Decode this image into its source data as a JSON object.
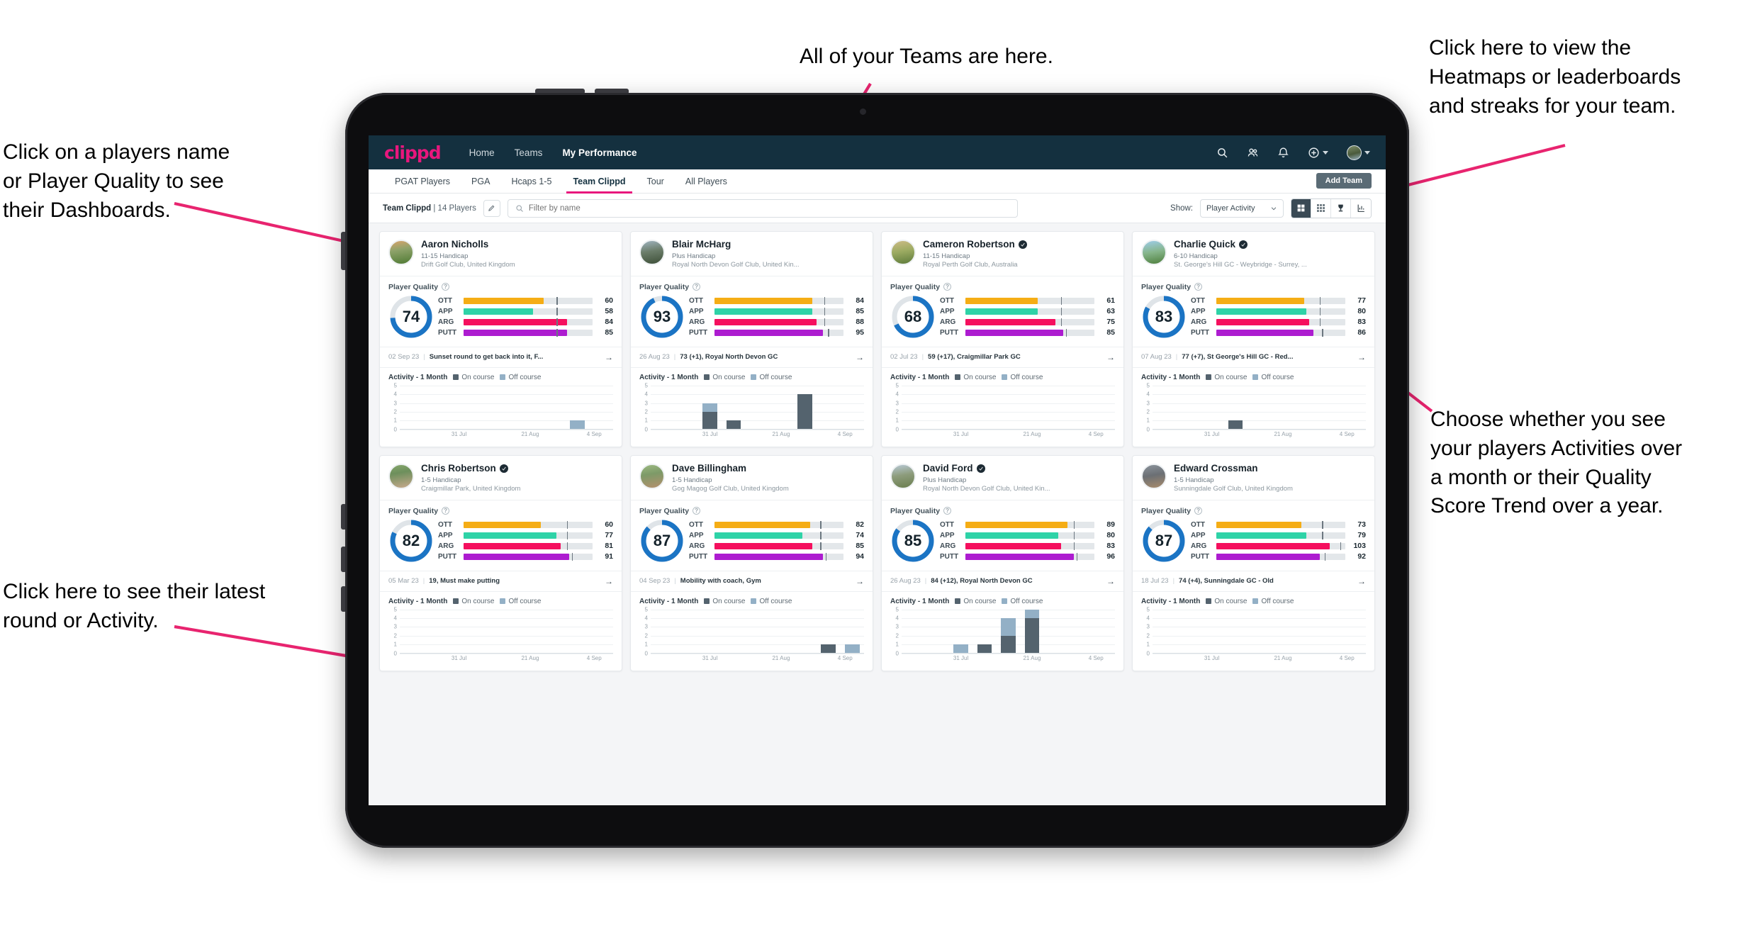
{
  "annotations": [
    {
      "id": "teams",
      "text": "All of your Teams are here."
    },
    {
      "id": "heatmaps",
      "text": "Click here to view the\nHeatmaps or leaderboards\nand streaks for your team."
    },
    {
      "id": "players",
      "text": "Click on a players name\nor Player Quality to see\ntheir Dashboards."
    },
    {
      "id": "activity-choice",
      "text": "Choose whether you see\nyour players Activities over\na month or their Quality\nScore Trend over a year."
    },
    {
      "id": "latest-round",
      "text": "Click here to see their latest\nround or Activity."
    }
  ],
  "app": {
    "logo": "clippd",
    "nav": [
      {
        "label": "Home",
        "active": false
      },
      {
        "label": "Teams",
        "active": false
      },
      {
        "label": "My Performance",
        "active": true
      }
    ],
    "nav_icons": [
      "search-icon",
      "people-icon",
      "bell-icon",
      "plus-circle-icon",
      "avatar"
    ],
    "tabs": [
      {
        "label": "PGAT Players",
        "active": false
      },
      {
        "label": "PGA",
        "active": false
      },
      {
        "label": "Hcaps 1-5",
        "active": false
      },
      {
        "label": "Team Clippd",
        "active": true
      },
      {
        "label": "Tour",
        "active": false
      },
      {
        "label": "All Players",
        "active": false
      }
    ],
    "add_team_label": "Add Team",
    "filter_bar": {
      "team_name": "Team Clippd",
      "team_count": "| 14 Players",
      "search_placeholder": "Filter by name",
      "search_value": "",
      "show_label": "Show:",
      "show_value": "Player Activity",
      "view_buttons": [
        "grid-large-icon",
        "grid-small-icon",
        "trophy-icon",
        "streak-icon"
      ]
    },
    "accent_pink": "#e8177d",
    "nav_bg": "#14303f"
  },
  "card_labels": {
    "player_quality": "Player Quality",
    "activity_title": "Activity - 1 Month",
    "legend_on": "On course",
    "legend_off": "Off course",
    "metrics": [
      "OTT",
      "APP",
      "ARG",
      "PUTT"
    ],
    "arrow": "→"
  },
  "chart_data": {
    "type": "bar",
    "title": "Activity - 1 Month",
    "ylabel": "",
    "xlabel": "",
    "ylim": [
      0,
      5
    ],
    "yticks": [
      0,
      1,
      2,
      3,
      4,
      5
    ],
    "xticks": [
      "31 Jul",
      "21 Aug",
      "4 Sep"
    ],
    "grid": true,
    "legend": [
      "On course",
      "Off course"
    ],
    "colors": {
      "on_course": "#54636e",
      "off_course": "#93b0c6"
    },
    "stacked": true,
    "panels": [
      {
        "player": "Aaron Nicholls",
        "bars": [
          {
            "slot": 7,
            "on": 0,
            "off": 1
          }
        ]
      },
      {
        "player": "Blair McHarg",
        "bars": [
          {
            "slot": 2,
            "on": 2,
            "off": 1
          },
          {
            "slot": 3,
            "on": 1,
            "off": 0
          },
          {
            "slot": 6,
            "on": 4,
            "off": 0
          }
        ]
      },
      {
        "player": "Cameron Robertson",
        "bars": []
      },
      {
        "player": "Charlie Quick",
        "bars": [
          {
            "slot": 3,
            "on": 1,
            "off": 0
          }
        ]
      },
      {
        "player": "Chris Robertson",
        "bars": []
      },
      {
        "player": "Dave Billingham",
        "bars": [
          {
            "slot": 7,
            "on": 1,
            "off": 0
          },
          {
            "slot": 8,
            "on": 0,
            "off": 1
          }
        ]
      },
      {
        "player": "David Ford",
        "bars": [
          {
            "slot": 2,
            "on": 0,
            "off": 1
          },
          {
            "slot": 3,
            "on": 1,
            "off": 0
          },
          {
            "slot": 4,
            "on": 2,
            "off": 2
          },
          {
            "slot": 5,
            "on": 4,
            "off": 1
          }
        ]
      },
      {
        "player": "Edward Crossman",
        "bars": []
      }
    ]
  },
  "players": [
    {
      "name": "Aaron Nicholls",
      "verified": false,
      "handicap": "11-15 Handicap",
      "club": "Drift Golf Club, United Kingdom",
      "quality": 74,
      "avatar_css": "linear-gradient(170deg,#d9a36b 0%,#8fa36b 38%,#4f7a33 100%)",
      "metrics": [
        {
          "label": "OTT",
          "value": 60,
          "fill": 62,
          "tick": 72,
          "color": "#f5ad15"
        },
        {
          "label": "APP",
          "value": 58,
          "fill": 54,
          "tick": 72,
          "color": "#2ed3a7"
        },
        {
          "label": "ARG",
          "value": 84,
          "fill": 80,
          "tick": 72,
          "color": "#f50f5e"
        },
        {
          "label": "PUTT",
          "value": 85,
          "fill": 80,
          "tick": 72,
          "color": "#ad1cd0"
        }
      ],
      "round": {
        "date": "02 Sep 23",
        "text": "Sunset round to get back into it, F..."
      }
    },
    {
      "name": "Blair McHarg",
      "verified": false,
      "handicap": "Plus Handicap",
      "club": "Royal North Devon Golf Club, United Kin...",
      "quality": 93,
      "avatar_css": "linear-gradient(170deg,#9fb3bf 0%,#6b7d6a 45%,#3d4f38 100%)",
      "metrics": [
        {
          "label": "OTT",
          "value": 84,
          "fill": 76,
          "tick": 85,
          "color": "#f5ad15"
        },
        {
          "label": "APP",
          "value": 85,
          "fill": 76,
          "tick": 85,
          "color": "#2ed3a7"
        },
        {
          "label": "ARG",
          "value": 88,
          "fill": 79,
          "tick": 85,
          "color": "#f50f5e"
        },
        {
          "label": "PUTT",
          "value": 95,
          "fill": 84,
          "tick": 88,
          "color": "#ad1cd0"
        }
      ],
      "round": {
        "date": "26 Aug 23",
        "text": "73 (+1), Royal North Devon GC"
      }
    },
    {
      "name": "Cameron Robertson",
      "verified": true,
      "handicap": "11-15 Handicap",
      "club": "Royal Perth Golf Club, Australia",
      "quality": 68,
      "avatar_css": "linear-gradient(170deg,#cdbb86 0%,#9cab62 45%,#5d7a3a 100%)",
      "metrics": [
        {
          "label": "OTT",
          "value": 61,
          "fill": 56,
          "tick": 74,
          "color": "#f5ad15"
        },
        {
          "label": "APP",
          "value": 63,
          "fill": 56,
          "tick": 74,
          "color": "#2ed3a7"
        },
        {
          "label": "ARG",
          "value": 75,
          "fill": 70,
          "tick": 74,
          "color": "#f50f5e"
        },
        {
          "label": "PUTT",
          "value": 85,
          "fill": 76,
          "tick": 78,
          "color": "#ad1cd0"
        }
      ],
      "round": {
        "date": "02 Jul 23",
        "text": "59 (+17), Craigmillar Park GC"
      }
    },
    {
      "name": "Charlie Quick",
      "verified": true,
      "handicap": "6-10 Handicap",
      "club": "St. George's Hill GC - Weybridge - Surrey, ...",
      "quality": 83,
      "avatar_css": "linear-gradient(170deg,#9ecdea 0%,#86b58b 48%,#4e7f3c 100%)",
      "metrics": [
        {
          "label": "OTT",
          "value": 77,
          "fill": 68,
          "tick": 80,
          "color": "#f5ad15"
        },
        {
          "label": "APP",
          "value": 80,
          "fill": 70,
          "tick": 80,
          "color": "#2ed3a7"
        },
        {
          "label": "ARG",
          "value": 83,
          "fill": 72,
          "tick": 80,
          "color": "#f50f5e"
        },
        {
          "label": "PUTT",
          "value": 86,
          "fill": 75,
          "tick": 82,
          "color": "#ad1cd0"
        }
      ],
      "round": {
        "date": "07 Aug 23",
        "text": "77 (+7), St George's Hill GC - Red..."
      }
    },
    {
      "name": "Chris Robertson",
      "verified": true,
      "handicap": "1-5 Handicap",
      "club": "Craigmillar Park, United Kingdom",
      "quality": 82,
      "avatar_css": "linear-gradient(170deg,#87a86d 0%,#6d8f5c 35%,#c8a98d 100%)",
      "metrics": [
        {
          "label": "OTT",
          "value": 60,
          "fill": 60,
          "tick": 80,
          "color": "#f5ad15"
        },
        {
          "label": "APP",
          "value": 77,
          "fill": 72,
          "tick": 80,
          "color": "#2ed3a7"
        },
        {
          "label": "ARG",
          "value": 81,
          "fill": 75,
          "tick": 80,
          "color": "#f50f5e"
        },
        {
          "label": "PUTT",
          "value": 91,
          "fill": 82,
          "tick": 84,
          "color": "#ad1cd0"
        }
      ],
      "round": {
        "date": "05 Mar 23",
        "text": "19, Must make putting"
      }
    },
    {
      "name": "Dave Billingham",
      "verified": false,
      "handicap": "1-5 Handicap",
      "club": "Gog Magog Golf Club, United Kingdom",
      "quality": 87,
      "avatar_css": "linear-gradient(170deg,#9dba82 0%,#7d9a68 40%,#b4906d 100%)",
      "metrics": [
        {
          "label": "OTT",
          "value": 82,
          "fill": 74,
          "tick": 82,
          "color": "#f5ad15"
        },
        {
          "label": "APP",
          "value": 74,
          "fill": 68,
          "tick": 82,
          "color": "#2ed3a7"
        },
        {
          "label": "ARG",
          "value": 85,
          "fill": 76,
          "tick": 82,
          "color": "#f50f5e"
        },
        {
          "label": "PUTT",
          "value": 94,
          "fill": 84,
          "tick": 86,
          "color": "#ad1cd0"
        }
      ],
      "round": {
        "date": "04 Sep 23",
        "text": "Mobility with coach, Gym"
      }
    },
    {
      "name": "David Ford",
      "verified": true,
      "handicap": "Plus Handicap",
      "club": "Royal North Devon Golf Club, United Kin...",
      "quality": 85,
      "avatar_css": "linear-gradient(170deg,#b8c9d6 0%,#8d9c7c 45%,#6a7e4e 100%)",
      "metrics": [
        {
          "label": "OTT",
          "value": 89,
          "fill": 79,
          "tick": 84,
          "color": "#f5ad15"
        },
        {
          "label": "APP",
          "value": 80,
          "fill": 72,
          "tick": 84,
          "color": "#2ed3a7"
        },
        {
          "label": "ARG",
          "value": 83,
          "fill": 74,
          "tick": 84,
          "color": "#f50f5e"
        },
        {
          "label": "PUTT",
          "value": 96,
          "fill": 84,
          "tick": 86,
          "color": "#ad1cd0"
        }
      ],
      "round": {
        "date": "26 Aug 23",
        "text": "84 (+12), Royal North Devon GC"
      }
    },
    {
      "name": "Edward Crossman",
      "verified": false,
      "handicap": "1-5 Handicap",
      "club": "Sunningdale Golf Club, United Kingdom",
      "quality": 87,
      "avatar_css": "linear-gradient(170deg,#8c949c 0%,#6b6f74 45%,#a88b6c 100%)",
      "metrics": [
        {
          "label": "OTT",
          "value": 73,
          "fill": 66,
          "tick": 82,
          "color": "#f5ad15"
        },
        {
          "label": "APP",
          "value": 79,
          "fill": 70,
          "tick": 82,
          "color": "#2ed3a7"
        },
        {
          "label": "ARG",
          "value": 103,
          "fill": 88,
          "tick": 96,
          "color": "#f50f5e"
        },
        {
          "label": "PUTT",
          "value": 92,
          "fill": 80,
          "tick": 84,
          "color": "#ad1cd0"
        }
      ],
      "round": {
        "date": "18 Jul 23",
        "text": "74 (+4), Sunningdale GC - Old"
      }
    }
  ]
}
